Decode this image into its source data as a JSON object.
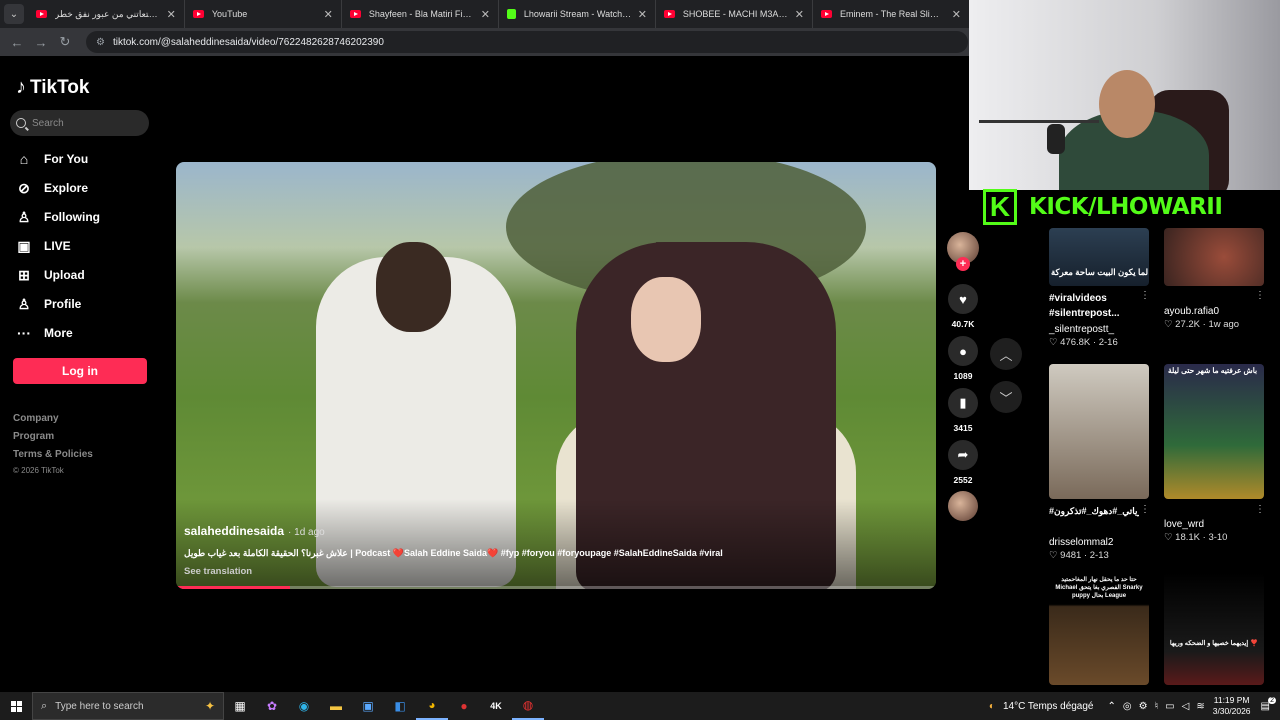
{
  "browser": {
    "tabs": [
      {
        "title": "الشرطة متعاتني من عبور نفق خطر",
        "favicon": "youtube-icon"
      },
      {
        "title": "YouTube",
        "favicon": "youtube-icon"
      },
      {
        "title": "Shayfeen - Bla Matiri Fihoum (O",
        "favicon": "youtube-icon"
      },
      {
        "title": "Lhowarii Stream - Watch Live on K",
        "favicon": "kick-icon"
      },
      {
        "title": "SHOBEE - MACHI M3ANA - You",
        "favicon": "youtube-icon"
      },
      {
        "title": "Eminem - The Real Slim Shady",
        "favicon": "youtube-icon"
      }
    ],
    "url": "tiktok.com/@salaheddinesaida/video/7622482628746202390"
  },
  "sidebar": {
    "logo": "TikTok",
    "search_placeholder": "Search",
    "items": [
      {
        "label": "For You",
        "icon": "home-icon"
      },
      {
        "label": "Explore",
        "icon": "compass-icon"
      },
      {
        "label": "Following",
        "icon": "user-icon"
      },
      {
        "label": "LIVE",
        "icon": "live-icon"
      },
      {
        "label": "Upload",
        "icon": "plus-square-icon"
      },
      {
        "label": "Profile",
        "icon": "profile-icon"
      },
      {
        "label": "More",
        "icon": "more-icon"
      }
    ],
    "login_label": "Log in",
    "footer": [
      "Company",
      "Program",
      "Terms & Policies"
    ],
    "copyright": "© 2026 TikTok"
  },
  "video": {
    "author": "salaheddinesaida",
    "posted": "· 1d ago",
    "caption": "علاش غبرنا؟ الحقيقة الكاملة بعد غياب طويل | Podcast ❤️Salah Eddine Saida❤️ #fyp #foryou #foryoupage #SalahEddineSaida #viral",
    "translate": "See translation",
    "progress": 0.15
  },
  "actions": {
    "likes": "40.7K",
    "comments": "1089",
    "saves": "3415",
    "shares": "2552"
  },
  "overlay": {
    "kick_letter": "K",
    "kick_text": "KICK/LHOWARII"
  },
  "grid": [
    {
      "thumb_text": "لما يكون البيت ساحة معركة",
      "title": "#viralvideos #silentrepost...",
      "author": "_silentrepostt_",
      "likes": "476.8K",
      "date": "2-16"
    },
    {
      "thumb_text": "",
      "title": "",
      "author": "ayoub.rafia0",
      "likes": "27.2K",
      "date": "1w ago"
    },
    {
      "thumb_text": "",
      "title": "#ذكرياتي_#دهوك_#تذكرون_#",
      "author": "drisselommal2",
      "likes": "9481",
      "date": "2-13"
    },
    {
      "thumb_text": "باش عرفتيه ما شهر حتى ليلة",
      "title": "",
      "author": "love_wrd",
      "likes": "18.1K",
      "date": "3-10"
    },
    {
      "thumb_text": "حتا حد ما يحقل نهار المغاحمتيد Michael الفصري بغا يتحق Snarky puppy بحال League",
      "title": "",
      "author": "",
      "likes": "",
      "date": ""
    },
    {
      "thumb_text": "إيديهما خصيها و الضحكه وريها ❣️",
      "title": "",
      "author": "",
      "likes": "",
      "date": ""
    }
  ],
  "taskbar": {
    "search_placeholder": "Type here to search",
    "weather": "14°C  Temps dégagé",
    "time": "11:19 PM",
    "date": "3/30/2026",
    "notifications": "2"
  },
  "colors": {
    "tiktok_red": "#fe2c55",
    "kick_green": "#53fc18"
  }
}
